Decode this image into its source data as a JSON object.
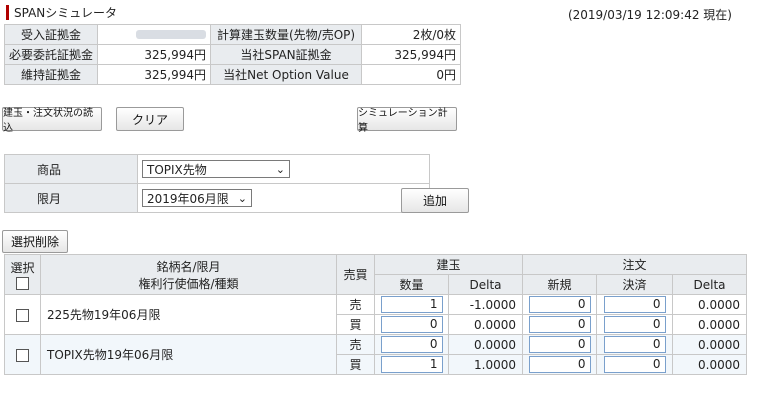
{
  "header": {
    "title": "SPANシミュレータ",
    "timestamp": "(2019/03/19 12:09:42 現在)"
  },
  "summary": {
    "received_margin_label": "受入証拠金",
    "required_margin_label": "必要委託証拠金",
    "required_margin_value": "325,994円",
    "maintenance_margin_label": "維持証拠金",
    "maintenance_margin_value": "325,994円",
    "calc_qty_label": "計算建玉数量(先物/売OP)",
    "calc_qty_value": "2枚/0枚",
    "span_margin_label": "当社SPAN証拠金",
    "span_margin_value": "325,994円",
    "net_option_label": "当社Net Option Value",
    "net_option_value": "0円"
  },
  "buttons": {
    "load_positions": "建玉・注文状況の読込",
    "clear": "クリア",
    "simulate": "シミュレーション計算",
    "add": "追加",
    "delete_selected": "選択削除"
  },
  "form": {
    "product_label": "商品",
    "product_value": "TOPIX先物",
    "month_label": "限月",
    "month_value": "2019年06月限"
  },
  "grid": {
    "headers": {
      "select": "選択",
      "name_line1": "銘柄名/限月",
      "name_line2": "権利行使価格/種類",
      "side": "売買",
      "position": "建玉",
      "order": "注文",
      "qty": "数量",
      "delta": "Delta",
      "new": "新規",
      "settle": "決済",
      "order_delta": "Delta"
    },
    "rows": [
      {
        "name": "225先物19年06月限",
        "sell": {
          "side": "売",
          "qty": "1",
          "delta": "-1.0000",
          "new": "0",
          "settle": "0",
          "order_delta": "0.0000"
        },
        "buy": {
          "side": "買",
          "qty": "0",
          "delta": "0.0000",
          "new": "0",
          "settle": "0",
          "order_delta": "0.0000"
        }
      },
      {
        "name": "TOPIX先物19年06月限",
        "sell": {
          "side": "売",
          "qty": "0",
          "delta": "0.0000",
          "new": "0",
          "settle": "0",
          "order_delta": "0.0000"
        },
        "buy": {
          "side": "買",
          "qty": "1",
          "delta": "1.0000",
          "new": "0",
          "settle": "0",
          "order_delta": "0.0000"
        }
      }
    ]
  }
}
